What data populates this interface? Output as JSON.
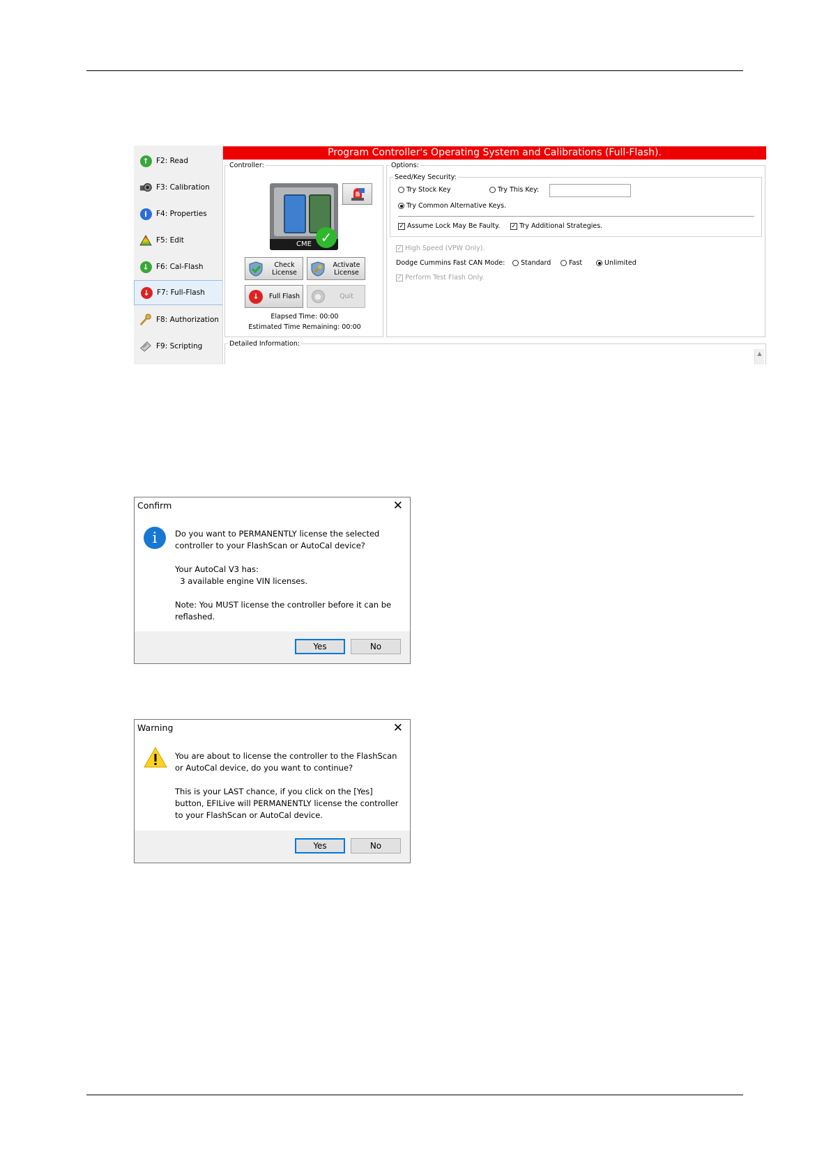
{
  "sidebar": {
    "items": [
      {
        "label": "F2: Read",
        "icon": "up-arrow-icon"
      },
      {
        "label": "F3: Calibration",
        "icon": "camera-icon"
      },
      {
        "label": "F4: Properties",
        "icon": "info-icon"
      },
      {
        "label": "F5: Edit",
        "icon": "triangle-icon"
      },
      {
        "label": "F6: Cal-Flash",
        "icon": "down-arrow-green-icon"
      },
      {
        "label": "F7: Full-Flash",
        "icon": "down-arrow-red-icon"
      },
      {
        "label": "F8: Authorization",
        "icon": "key-icon"
      },
      {
        "label": "F9: Scripting",
        "icon": "scroll-icon"
      }
    ]
  },
  "banner": "Program Controller's Operating System and Calibrations (Full-Flash).",
  "controller": {
    "legend": "Controller:",
    "ecm_label": "CME",
    "check_license": [
      "Check",
      "License"
    ],
    "activate_license": [
      "Activate",
      "License"
    ],
    "full_flash": "Full Flash",
    "quit": "Quit",
    "elapsed": "Elapsed Time: 00:00",
    "remaining": "Estimated Time Remaining: 00:00"
  },
  "options": {
    "legend": "Options:",
    "seed_legend": "Seed/Key Security:",
    "try_stock_key": "Try Stock Key",
    "try_this_key": "Try This Key:",
    "try_this_key_value": "",
    "try_common": "Try Common Alternative Keys.",
    "assume_lock": "Assume Lock May Be Faulty.",
    "try_additional": "Try Additional Strategies.",
    "high_speed": "High Speed (VPW Only).",
    "dodge_label": "Dodge Cummins Fast CAN Mode:",
    "mode_standard": "Standard",
    "mode_fast": "Fast",
    "mode_unlimited": "Unlimited",
    "perform_test": "Perform Test Flash Only."
  },
  "detailed": {
    "legend": "Detailed Information:"
  },
  "confirm": {
    "title": "Confirm",
    "close": "✕",
    "message": "Do you want to PERMANENTLY license the selected\ncontroller to your FlashScan or AutoCal device?\n\nYour AutoCal V3 has:\n  3 available engine VIN licenses.\n\nNote: You MUST license the controller before it can be\nreflashed.",
    "yes": "Yes",
    "no": "No"
  },
  "warning": {
    "title": "Warning",
    "close": "✕",
    "message": "You are about to license the controller to the FlashScan\nor AutoCal device, do you want to continue?\n\nThis is your LAST chance, if you click on the [Yes]\nbutton, EFILive will PERMANENTLY license the controller\nto your FlashScan or AutoCal device.",
    "yes": "Yes",
    "no": "No"
  },
  "colors": {
    "banner": "#ee0000",
    "accent": "#0078d7"
  }
}
